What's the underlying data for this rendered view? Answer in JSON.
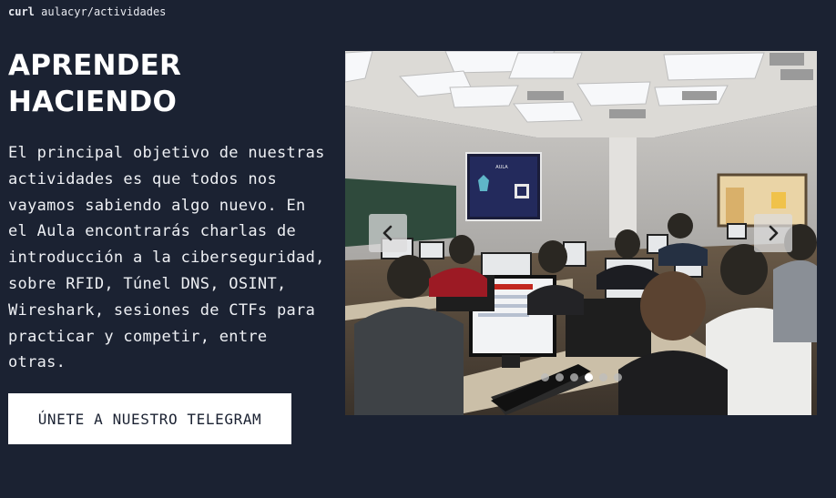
{
  "prompt": {
    "cmd": "curl",
    "path": "aulacyr/actividades"
  },
  "section": {
    "title_line1": "APRENDER",
    "title_line2": "HACIENDO",
    "description": "El principal objetivo de nuestras actividades es que todos nos vayamos sabiendo algo nuevo. En el Aula encontrarás charlas de introducción a la ciberseguridad, sobre RFID, Túnel DNS, OSINT, Wireshark, sesiones de CTFs para practicar y competir, entre otras.",
    "cta_label": "ÚNETE A NUESTRO TELEGRAM"
  },
  "carousel": {
    "slide_count": 6,
    "active_index": 3,
    "prev_icon": "chevron-left-icon",
    "next_icon": "chevron-right-icon",
    "projector_screen_text": "AULA"
  },
  "colors": {
    "background": "#1b2232",
    "text": "#ffffff",
    "button_bg": "#ffffff",
    "button_text": "#1b2232"
  }
}
